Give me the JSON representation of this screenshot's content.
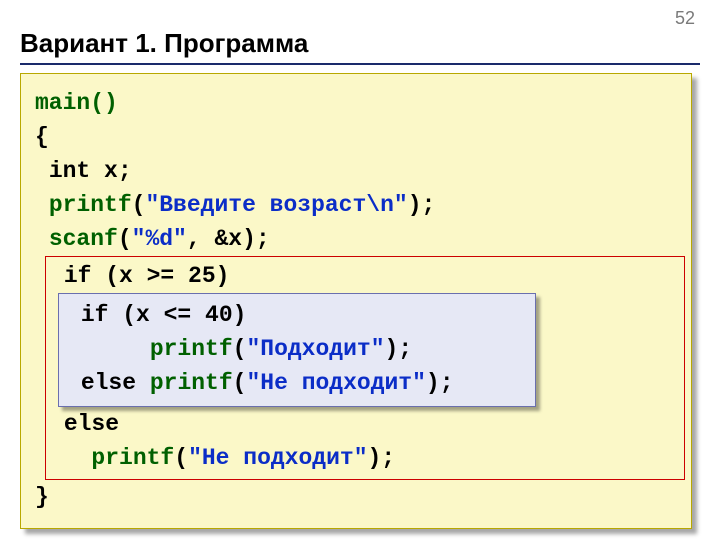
{
  "page_number": "52",
  "title": "Вариант 1. Программа",
  "code": {
    "l1_main": "main()",
    "l2_brace": "{",
    "l3_pre": " ",
    "l3_type": "int",
    "l3_rest": " x;",
    "l4_pre": " ",
    "l4_fn": "printf",
    "l4_paren1": "(",
    "l4_str": "\"Введите возраст\\n\"",
    "l4_paren2": ");",
    "l5_pre": " ",
    "l5_fn": "scanf",
    "l5_paren1": "(",
    "l5_str": "\"%d\"",
    "l5_rest": ", &x);",
    "l6_pre": " ",
    "l6_kw": "if",
    "l6_rest": " (x >= 25)",
    "l7_pre": " ",
    "l7_kw": "if",
    "l7_rest": " (x <= 40)",
    "l8_pre": "      ",
    "l8_fn": "printf",
    "l8_paren1": "(",
    "l8_str": "\"Подходит\"",
    "l8_paren2": ");",
    "l9_pre": " ",
    "l9_kw": "else",
    "l9_sp": " ",
    "l9_fn": "printf",
    "l9_paren1": "(",
    "l9_str": "\"Не подходит\"",
    "l9_paren2": ");",
    "l10_pre": " ",
    "l10_kw": "else",
    "l11_pre": "   ",
    "l11_fn": "printf",
    "l11_paren1": "(",
    "l11_str": "\"Не подходит\"",
    "l11_paren2": ");",
    "l12_brace": "}"
  }
}
